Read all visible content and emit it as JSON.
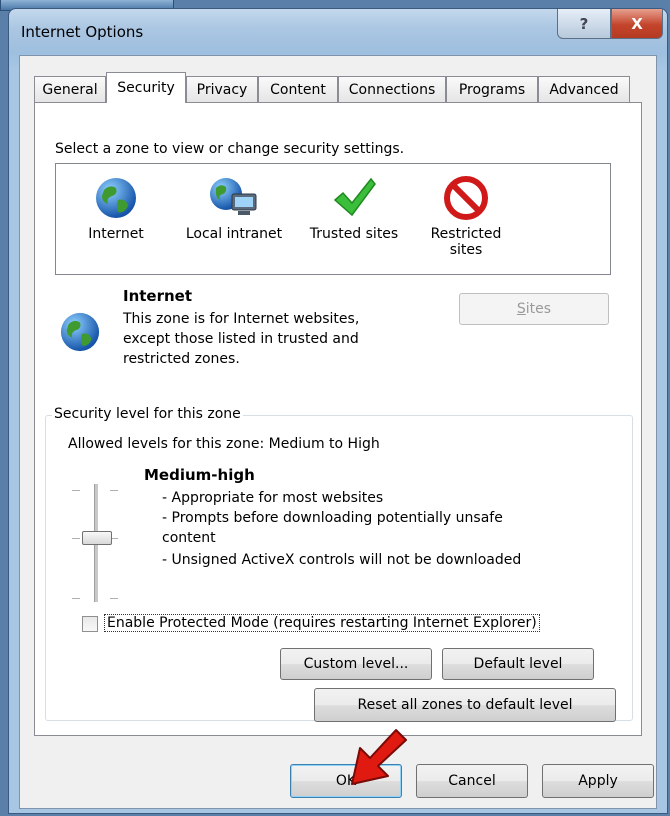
{
  "window": {
    "title": "Internet Options",
    "help_symbol": "?",
    "close_symbol": "X"
  },
  "tabs": [
    {
      "label": "General",
      "active": false
    },
    {
      "label": "Security",
      "active": true
    },
    {
      "label": "Privacy",
      "active": false
    },
    {
      "label": "Content",
      "active": false
    },
    {
      "label": "Connections",
      "active": false
    },
    {
      "label": "Programs",
      "active": false
    },
    {
      "label": "Advanced",
      "active": false
    }
  ],
  "security": {
    "zone_prompt": "Select a zone to view or change security settings.",
    "zones": [
      {
        "label": "Internet",
        "icon": "globe-icon"
      },
      {
        "label": "Local intranet",
        "icon": "network-globe-icon"
      },
      {
        "label": "Trusted sites",
        "icon": "checkmark-icon"
      },
      {
        "label": "Restricted sites",
        "label_line1": "Restricted",
        "label_line2": "sites",
        "icon": "no-entry-icon"
      }
    ],
    "selected_zone": {
      "name": "Internet",
      "desc_line1": "This zone is for Internet websites,",
      "desc_line2": "except those listed in trusted and",
      "desc_line3": "restricted zones.",
      "sites_button": "Sites",
      "sites_access_key": "S"
    },
    "level_group": {
      "label": "Security level for this zone",
      "allowed": "Allowed levels for this zone: Medium to High",
      "level_name": "Medium-high",
      "bullets": [
        "- Appropriate for most websites",
        "- Prompts before downloading potentially unsafe",
        "content",
        "- Unsigned ActiveX controls will not be downloaded"
      ],
      "protected_mode_label": "Enable Protected Mode (requires restarting Internet Explorer)",
      "protected_mode_checked": false,
      "custom_level_button": "Custom level...",
      "default_level_button": "Default level"
    },
    "reset_all_button": "Reset all zones to default level"
  },
  "footer": {
    "ok": "OK",
    "cancel": "Cancel",
    "apply": "Apply"
  },
  "colors": {
    "accent_arrow": "#e01a10",
    "title_bar": "#aac6e2",
    "close_button": "#c3442b"
  }
}
